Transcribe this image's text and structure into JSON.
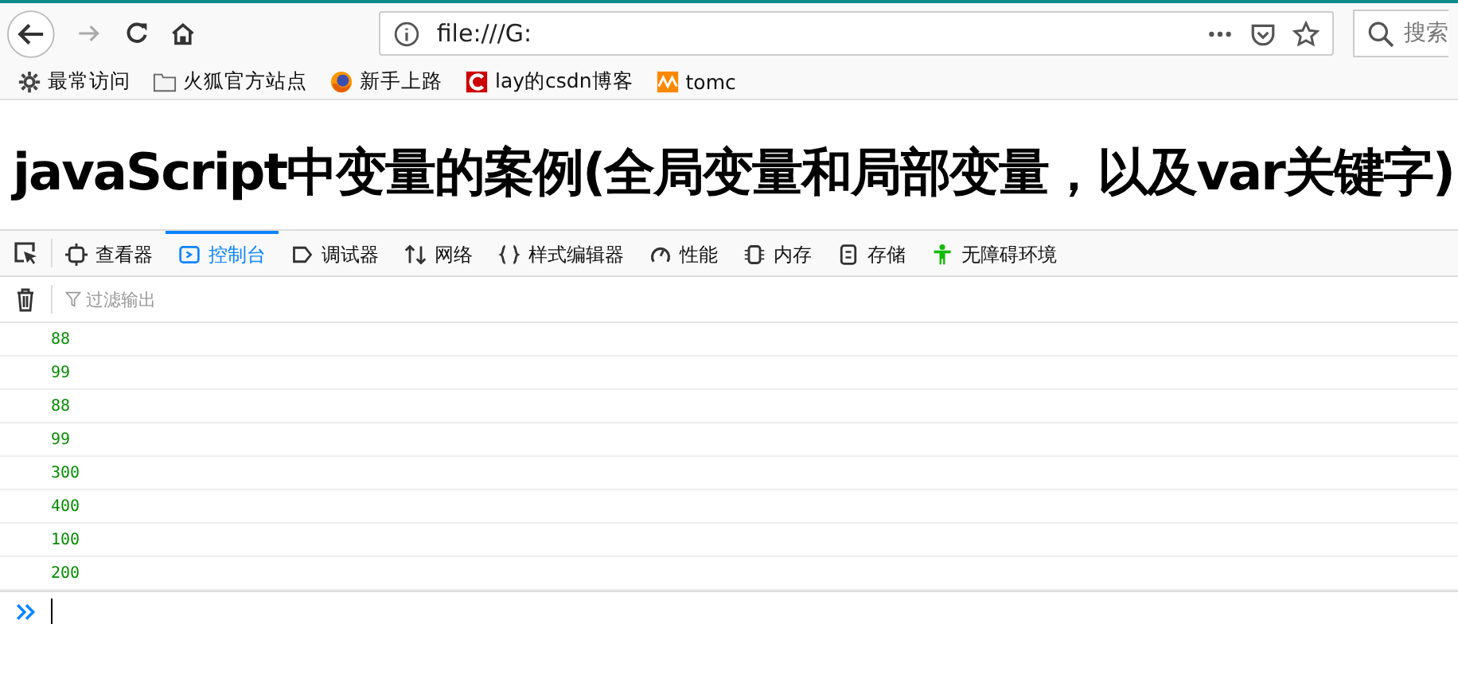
{
  "browser": {
    "url": "file:///G:",
    "search_placeholder": "搜索"
  },
  "bookmarks": [
    {
      "kind": "gear",
      "label": "最常访问"
    },
    {
      "kind": "folder",
      "label": "火狐官方站点"
    },
    {
      "kind": "firefox",
      "label": "新手上路"
    },
    {
      "kind": "csdn",
      "label": "lay的csdn博客"
    },
    {
      "kind": "tomcat",
      "label": "tomc"
    }
  ],
  "heading": "javaScript中变量的案例(全局变量和局部变量，以及var关键字)",
  "devtools": {
    "tabs": [
      {
        "kind": "inspector",
        "label": "查看器",
        "selected": false
      },
      {
        "kind": "console",
        "label": "控制台",
        "selected": true
      },
      {
        "kind": "debugger",
        "label": "调试器",
        "selected": false
      },
      {
        "kind": "network",
        "label": "网络",
        "selected": false
      },
      {
        "kind": "style",
        "label": "样式编辑器",
        "selected": false
      },
      {
        "kind": "performance",
        "label": "性能",
        "selected": false
      },
      {
        "kind": "memory",
        "label": "内存",
        "selected": false
      },
      {
        "kind": "storage",
        "label": "存储",
        "selected": false
      },
      {
        "kind": "accessibility",
        "label": "无障碍环境",
        "selected": false
      }
    ],
    "filter_placeholder": "过滤输出",
    "console_lines": [
      "88",
      "99",
      "88",
      "99",
      "300",
      "400",
      "100",
      "200"
    ]
  }
}
